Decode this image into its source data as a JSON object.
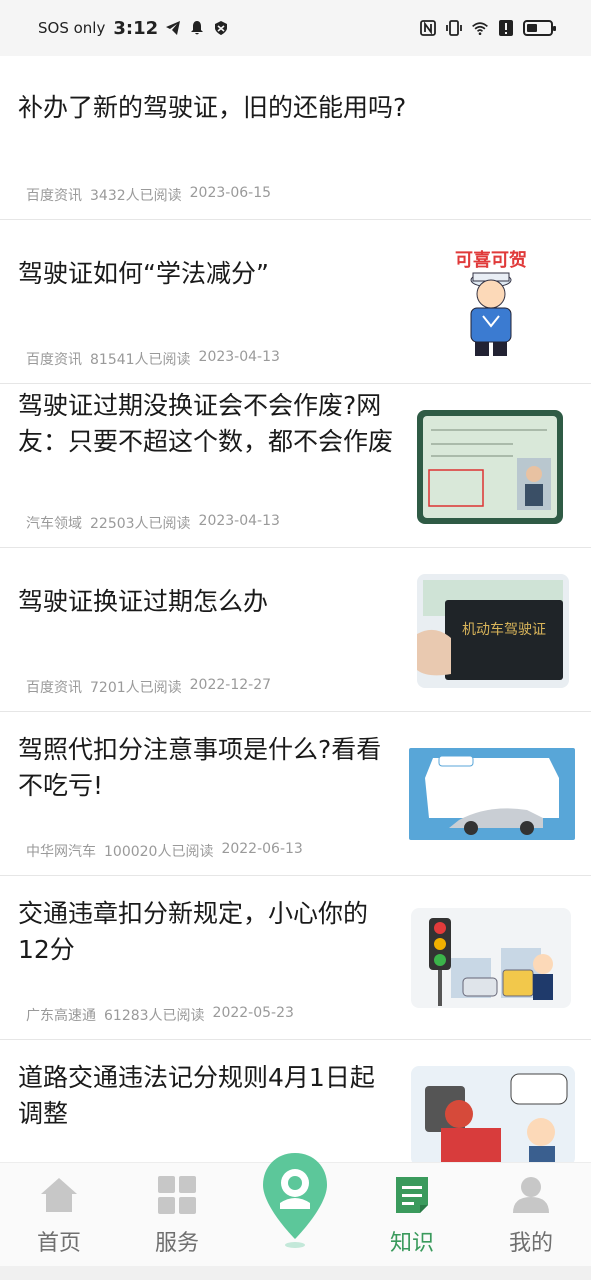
{
  "status_bar": {
    "carrier": "SOS only",
    "time": "3:12"
  },
  "articles": [
    {
      "title": "补办了新的驾驶证，旧的还能用吗?",
      "source": "百度资讯",
      "reads": "3432人已阅读",
      "date": "2023-06-15",
      "thumb": null
    },
    {
      "title": "驾驶证如何“学法减分”",
      "source": "百度资讯",
      "reads": "81541人已阅读",
      "date": "2023-04-13",
      "thumb": "cartoon-police-congrats",
      "thumb_text": "可喜可贺"
    },
    {
      "title": "驾驶证过期没换证会不会作废?网友：只要不超这个数，都不会作废",
      "source": "汽车领域",
      "reads": "22503人已阅读",
      "date": "2023-04-13",
      "thumb": "driver-license-card"
    },
    {
      "title": "驾驶证换证过期怎么办",
      "source": "百度资讯",
      "reads": "7201人已阅读",
      "date": "2022-12-27",
      "thumb": "license-booklet",
      "thumb_text": "机动车驾驶证"
    },
    {
      "title": "驾照代扣分注意事项是什么?看看不吃亏!",
      "source": "中华网汽车",
      "reads": "100020人已阅读",
      "date": "2022-06-13",
      "thumb": "car-on-blue"
    },
    {
      "title": "交通违章扣分新规定，小心你的12分",
      "source": "广东高速通",
      "reads": "61283人已阅读",
      "date": "2022-05-23",
      "thumb": "traffic-light-cartoon"
    },
    {
      "title": "道路交通违法记分规则4月1日起调整",
      "source": "",
      "reads": "",
      "date": "",
      "thumb": "traffic-rules-cartoon"
    }
  ],
  "nav": {
    "items": [
      {
        "label": "首页",
        "icon": "home-icon"
      },
      {
        "label": "服务",
        "icon": "grid-icon"
      },
      {
        "label": "知识",
        "icon": "note-icon"
      },
      {
        "label": "我的",
        "icon": "user-icon"
      }
    ],
    "center_icon": "location-pin-icon",
    "active_index": 2
  },
  "colors": {
    "accent": "#3a9a5c",
    "pin": "#5cc79a",
    "inactive": "#c7c7c7"
  }
}
